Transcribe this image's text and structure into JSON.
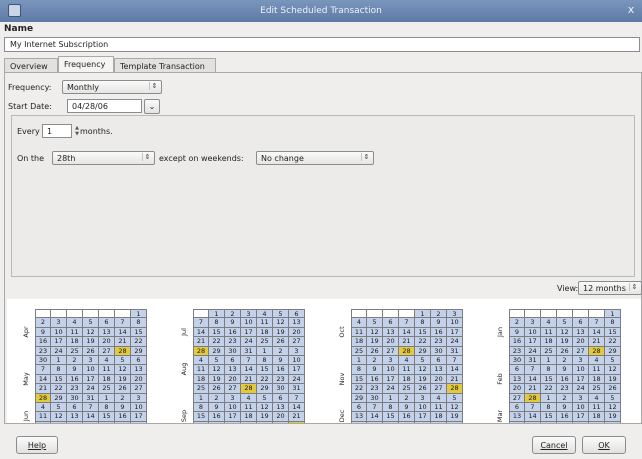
{
  "window": {
    "title": "Edit Scheduled Transaction",
    "close_glyph": "x"
  },
  "name_section": {
    "label": "Name",
    "value": "My Internet Subscription"
  },
  "tabs": [
    {
      "label": "Overview",
      "active": false
    },
    {
      "label": "Frequency",
      "active": true
    },
    {
      "label": "Template Transaction",
      "active": false
    }
  ],
  "frequency": {
    "frequency_label": "Frequency:",
    "frequency_value": "Monthly",
    "start_date_label": "Start Date:",
    "start_date_value": "04/28/06",
    "every_label": "Every",
    "every_value": "1",
    "months_label": "months.",
    "on_the_label": "On the",
    "day_value": "28th",
    "except_label": "except on weekends:",
    "weekend_value": "No change"
  },
  "view": {
    "label": "View:",
    "value": "12 months"
  },
  "calendar": {
    "highlight_color": "#e2c93d",
    "inmonth_color": "#c3d1ea",
    "months": [
      {
        "name": "Apr",
        "lead": 6,
        "days": 30,
        "hl": 28
      },
      {
        "name": "May",
        "lead": 1,
        "days": 31,
        "hl": 28
      },
      {
        "name": "Jun",
        "lead": 4,
        "days": 30,
        "hl": 28
      },
      {
        "name": "Jul",
        "lead": 6,
        "days": 31,
        "hl": 28
      },
      {
        "name": "Aug",
        "lead": 2,
        "days": 31,
        "hl": 28
      },
      {
        "name": "Sep",
        "lead": 5,
        "days": 30,
        "hl": 28
      },
      {
        "name": "Oct",
        "lead": 0,
        "days": 31,
        "hl": 28
      },
      {
        "name": "Nov",
        "lead": 3,
        "days": 30,
        "hl": 28
      },
      {
        "name": "Dec",
        "lead": 5,
        "days": 31,
        "hl": 28
      },
      {
        "name": "Jan",
        "lead": 1,
        "days": 31,
        "hl": 28
      },
      {
        "name": "Feb",
        "lead": 4,
        "days": 28,
        "hl": 28
      },
      {
        "name": "Mar",
        "lead": 4,
        "days": 31,
        "hl": 28
      }
    ]
  },
  "buttons": {
    "help": "Help",
    "cancel": "Cancel",
    "ok": "OK"
  }
}
